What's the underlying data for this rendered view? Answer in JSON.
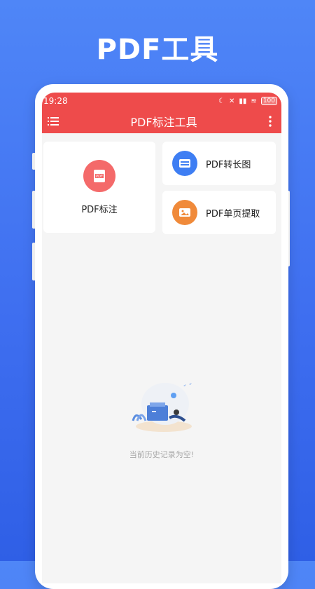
{
  "promo": {
    "title": "PDF工具"
  },
  "status_bar": {
    "time": "19:28",
    "battery": "100"
  },
  "app_bar": {
    "title": "PDF标注工具",
    "menu_icon": "list-menu-icon",
    "more_icon": "more-vertical-icon"
  },
  "tools": [
    {
      "label": "PDF标注",
      "icon": "pdf-file-icon",
      "color": "#f46a6a"
    },
    {
      "label": "PDF转长图",
      "icon": "long-image-icon",
      "color": "#3e7ef3"
    },
    {
      "label": "PDF单页提取",
      "icon": "image-extract-icon",
      "color": "#f08a3a"
    }
  ],
  "empty_state": {
    "message": "当前历史记录为空!",
    "illustration": "empty-history-illustration"
  },
  "colors": {
    "background": "#3f6ff0",
    "header": "#ee4b4b",
    "content_bg": "#f5f5f5"
  }
}
